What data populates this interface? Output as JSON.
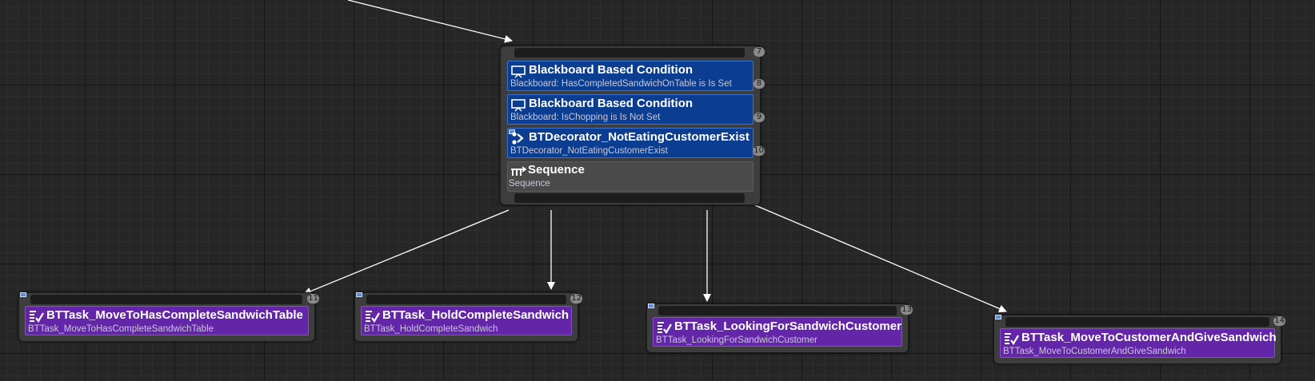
{
  "composite": {
    "index": "7",
    "decorators": [
      {
        "title": "Blackboard Based Condition",
        "subtitle": "Blackboard: HasCompletedSandwichOnTable is Is Set",
        "index": "8",
        "icon": "blackboard-icon"
      },
      {
        "title": "Blackboard Based Condition",
        "subtitle": "Blackboard: IsChopping is Is Not Set",
        "index": "9",
        "icon": "blackboard-icon"
      },
      {
        "title": "BTDecorator_NotEatingCustomerExist",
        "subtitle": "BTDecorator_NotEatingCustomerExist",
        "index": "10",
        "icon": "decorator-icon"
      }
    ],
    "sequence": {
      "title": "Sequence",
      "subtitle": "Sequence",
      "icon": "sequence-icon"
    }
  },
  "tasks": [
    {
      "title": "BTTask_MoveToHasCompleteSandwichTable",
      "subtitle": "BTTask_MoveToHasCompleteSandwichTable",
      "index": "11",
      "icon": "task-icon"
    },
    {
      "title": "BTTask_HoldCompleteSandwich",
      "subtitle": "BTTask_HoldCompleteSandwich",
      "index": "12",
      "icon": "task-icon"
    },
    {
      "title": "BTTask_LookingForSandwichCustomer",
      "subtitle": "BTTask_LookingForSandwichCustomer",
      "index": "13",
      "icon": "task-icon"
    },
    {
      "title": "BTTask_MoveToCustomerAndGiveSandwich",
      "subtitle": "BTTask_MoveToCustomerAndGiveSandwich",
      "index": "14",
      "icon": "task-icon"
    }
  ],
  "colors": {
    "graph_background": "#262626",
    "decorator": "#0b3d91",
    "task": "#6426a8",
    "composite": "#4a4a4a",
    "wire": "#ffffff"
  }
}
